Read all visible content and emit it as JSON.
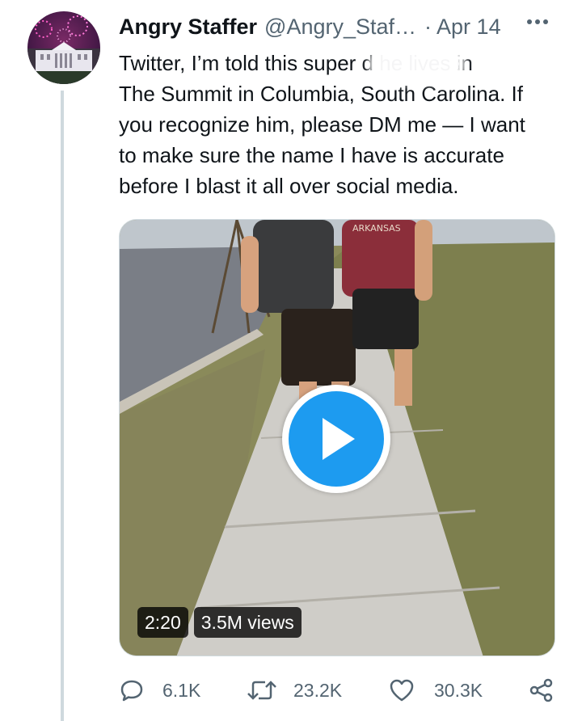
{
  "tweet": {
    "display_name": "Angry Staffer",
    "handle": "@Angry_Staf…",
    "separator": "·",
    "date": "Apr 14",
    "text": "Twitter, I’m told this super d    he lives in\nThe Summit in Columbia, South Carolina. If\nyou recognize him, please DM me — I want\nto make sure the name I have is accurate\nbefore I blast it all over social media."
  },
  "media": {
    "type": "video",
    "duration": "2:20",
    "views": "3.5M views",
    "shirt_text": "ARKANSAS"
  },
  "actions": {
    "replies": "6.1K",
    "retweets": "23.2K",
    "likes": "30.3K"
  },
  "icons": [
    "more-icon",
    "reply-icon",
    "retweet-icon",
    "like-icon",
    "share-icon",
    "play-icon"
  ],
  "colors": {
    "accent": "#1d9bf0",
    "muted": "#536471",
    "text": "#0f1419",
    "thread_line": "#cfd9de"
  }
}
